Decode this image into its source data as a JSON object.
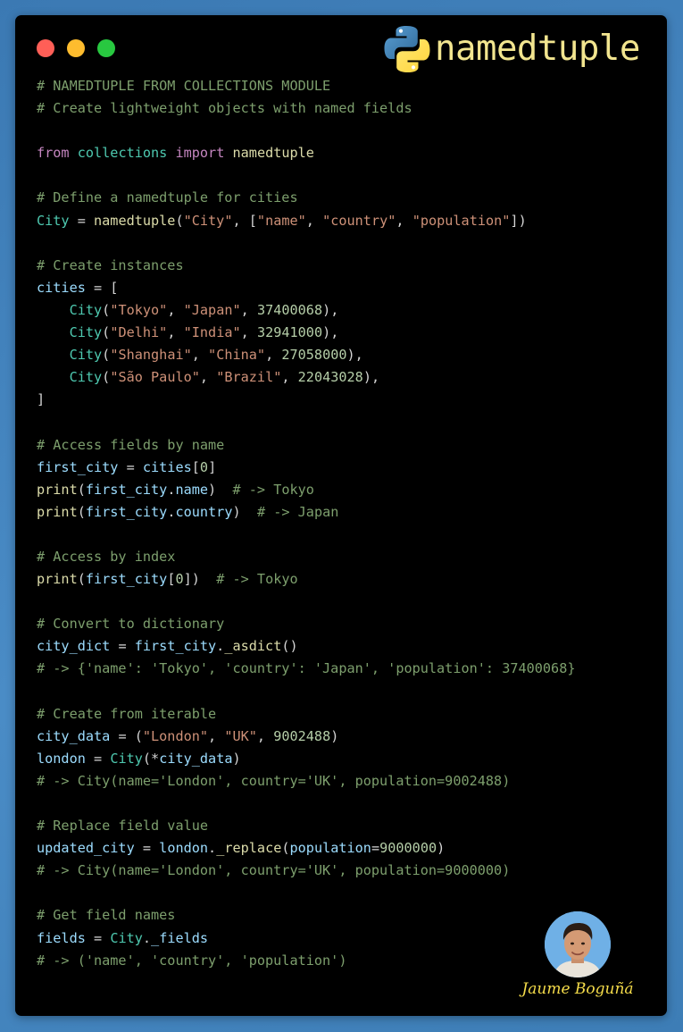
{
  "window": {
    "title": "namedtuple",
    "logo_icon": "python-logo-icon",
    "traffic_lights": [
      {
        "name": "close",
        "color": "#ff5f57"
      },
      {
        "name": "minimize",
        "color": "#febc2e"
      },
      {
        "name": "maximize",
        "color": "#28c840"
      }
    ]
  },
  "colors": {
    "background": "#3f7fb8",
    "editor_background": "#000000",
    "comment": "#7d9f6d",
    "keyword": "#c586c0",
    "class_module": "#4ec9b0",
    "function": "#dcdcaa",
    "variable": "#9cdcfe",
    "string": "#ce9178",
    "number": "#b5cea8",
    "title": "#f2e58f",
    "signature": "#f5dc4a"
  },
  "code": {
    "lines": [
      [
        [
          "comment",
          "# NAMEDTUPLE FROM COLLECTIONS MODULE"
        ]
      ],
      [
        [
          "comment",
          "# Create lightweight objects with named fields"
        ]
      ],
      [],
      [
        [
          "keyword",
          "from"
        ],
        [
          "plain",
          " "
        ],
        [
          "module",
          "collections"
        ],
        [
          "plain",
          " "
        ],
        [
          "keyword",
          "import"
        ],
        [
          "plain",
          " "
        ],
        [
          "func",
          "namedtuple"
        ]
      ],
      [],
      [
        [
          "comment",
          "# Define a namedtuple for cities"
        ]
      ],
      [
        [
          "class",
          "City"
        ],
        [
          "plain",
          " = "
        ],
        [
          "func",
          "namedtuple"
        ],
        [
          "punct",
          "("
        ],
        [
          "string",
          "\"City\""
        ],
        [
          "punct",
          ", ["
        ],
        [
          "string",
          "\"name\""
        ],
        [
          "punct",
          ", "
        ],
        [
          "string",
          "\"country\""
        ],
        [
          "punct",
          ", "
        ],
        [
          "string",
          "\"population\""
        ],
        [
          "punct",
          "])"
        ]
      ],
      [],
      [
        [
          "comment",
          "# Create instances"
        ]
      ],
      [
        [
          "var",
          "cities"
        ],
        [
          "plain",
          " = ["
        ]
      ],
      [
        [
          "plain",
          "    "
        ],
        [
          "class",
          "City"
        ],
        [
          "punct",
          "("
        ],
        [
          "string",
          "\"Tokyo\""
        ],
        [
          "punct",
          ", "
        ],
        [
          "string",
          "\"Japan\""
        ],
        [
          "punct",
          ", "
        ],
        [
          "number",
          "37400068"
        ],
        [
          "punct",
          "),"
        ]
      ],
      [
        [
          "plain",
          "    "
        ],
        [
          "class",
          "City"
        ],
        [
          "punct",
          "("
        ],
        [
          "string",
          "\"Delhi\""
        ],
        [
          "punct",
          ", "
        ],
        [
          "string",
          "\"India\""
        ],
        [
          "punct",
          ", "
        ],
        [
          "number",
          "32941000"
        ],
        [
          "punct",
          "),"
        ]
      ],
      [
        [
          "plain",
          "    "
        ],
        [
          "class",
          "City"
        ],
        [
          "punct",
          "("
        ],
        [
          "string",
          "\"Shanghai\""
        ],
        [
          "punct",
          ", "
        ],
        [
          "string",
          "\"China\""
        ],
        [
          "punct",
          ", "
        ],
        [
          "number",
          "27058000"
        ],
        [
          "punct",
          "),"
        ]
      ],
      [
        [
          "plain",
          "    "
        ],
        [
          "class",
          "City"
        ],
        [
          "punct",
          "("
        ],
        [
          "string",
          "\"São Paulo\""
        ],
        [
          "punct",
          ", "
        ],
        [
          "string",
          "\"Brazil\""
        ],
        [
          "punct",
          ", "
        ],
        [
          "number",
          "22043028"
        ],
        [
          "punct",
          "),"
        ]
      ],
      [
        [
          "plain",
          "]"
        ]
      ],
      [],
      [
        [
          "comment",
          "# Access fields by name"
        ]
      ],
      [
        [
          "var",
          "first_city"
        ],
        [
          "plain",
          " = "
        ],
        [
          "var",
          "cities"
        ],
        [
          "punct",
          "["
        ],
        [
          "number",
          "0"
        ],
        [
          "punct",
          "]"
        ]
      ],
      [
        [
          "func",
          "print"
        ],
        [
          "punct",
          "("
        ],
        [
          "var",
          "first_city"
        ],
        [
          "punct",
          "."
        ],
        [
          "var",
          "name"
        ],
        [
          "punct",
          ")"
        ],
        [
          "plain",
          "  "
        ],
        [
          "comment",
          "# -> Tokyo"
        ]
      ],
      [
        [
          "func",
          "print"
        ],
        [
          "punct",
          "("
        ],
        [
          "var",
          "first_city"
        ],
        [
          "punct",
          "."
        ],
        [
          "var",
          "country"
        ],
        [
          "punct",
          ")"
        ],
        [
          "plain",
          "  "
        ],
        [
          "comment",
          "# -> Japan"
        ]
      ],
      [],
      [
        [
          "comment",
          "# Access by index"
        ]
      ],
      [
        [
          "func",
          "print"
        ],
        [
          "punct",
          "("
        ],
        [
          "var",
          "first_city"
        ],
        [
          "punct",
          "["
        ],
        [
          "number",
          "0"
        ],
        [
          "punct",
          "])"
        ],
        [
          "plain",
          "  "
        ],
        [
          "comment",
          "# -> Tokyo"
        ]
      ],
      [],
      [
        [
          "comment",
          "# Convert to dictionary"
        ]
      ],
      [
        [
          "var",
          "city_dict"
        ],
        [
          "plain",
          " = "
        ],
        [
          "var",
          "first_city"
        ],
        [
          "punct",
          "."
        ],
        [
          "func",
          "_asdict"
        ],
        [
          "punct",
          "()"
        ]
      ],
      [
        [
          "comment",
          "# -> {'name': 'Tokyo', 'country': 'Japan', 'population': 37400068}"
        ]
      ],
      [],
      [
        [
          "comment",
          "# Create from iterable"
        ]
      ],
      [
        [
          "var",
          "city_data"
        ],
        [
          "plain",
          " = ("
        ],
        [
          "string",
          "\"London\""
        ],
        [
          "punct",
          ", "
        ],
        [
          "string",
          "\"UK\""
        ],
        [
          "punct",
          ", "
        ],
        [
          "number",
          "9002488"
        ],
        [
          "punct",
          ")"
        ]
      ],
      [
        [
          "var",
          "london"
        ],
        [
          "plain",
          " = "
        ],
        [
          "class",
          "City"
        ],
        [
          "punct",
          "(*"
        ],
        [
          "var",
          "city_data"
        ],
        [
          "punct",
          ")"
        ]
      ],
      [
        [
          "comment",
          "# -> City(name='London', country='UK', population=9002488)"
        ]
      ],
      [],
      [
        [
          "comment",
          "# Replace field value"
        ]
      ],
      [
        [
          "var",
          "updated_city"
        ],
        [
          "plain",
          " = "
        ],
        [
          "var",
          "london"
        ],
        [
          "punct",
          "."
        ],
        [
          "func",
          "_replace"
        ],
        [
          "punct",
          "("
        ],
        [
          "var",
          "population"
        ],
        [
          "plain",
          "="
        ],
        [
          "number",
          "9000000"
        ],
        [
          "punct",
          ")"
        ]
      ],
      [
        [
          "comment",
          "# -> City(name='London', country='UK', population=9000000)"
        ]
      ],
      [],
      [
        [
          "comment",
          "# Get field names"
        ]
      ],
      [
        [
          "var",
          "fields"
        ],
        [
          "plain",
          " = "
        ],
        [
          "class",
          "City"
        ],
        [
          "punct",
          "."
        ],
        [
          "var",
          "_fields"
        ]
      ],
      [
        [
          "comment",
          "# -> ('name', 'country', 'population')"
        ]
      ]
    ]
  },
  "author": {
    "name": "Jaume Boguñá",
    "avatar_icon": "author-avatar"
  }
}
